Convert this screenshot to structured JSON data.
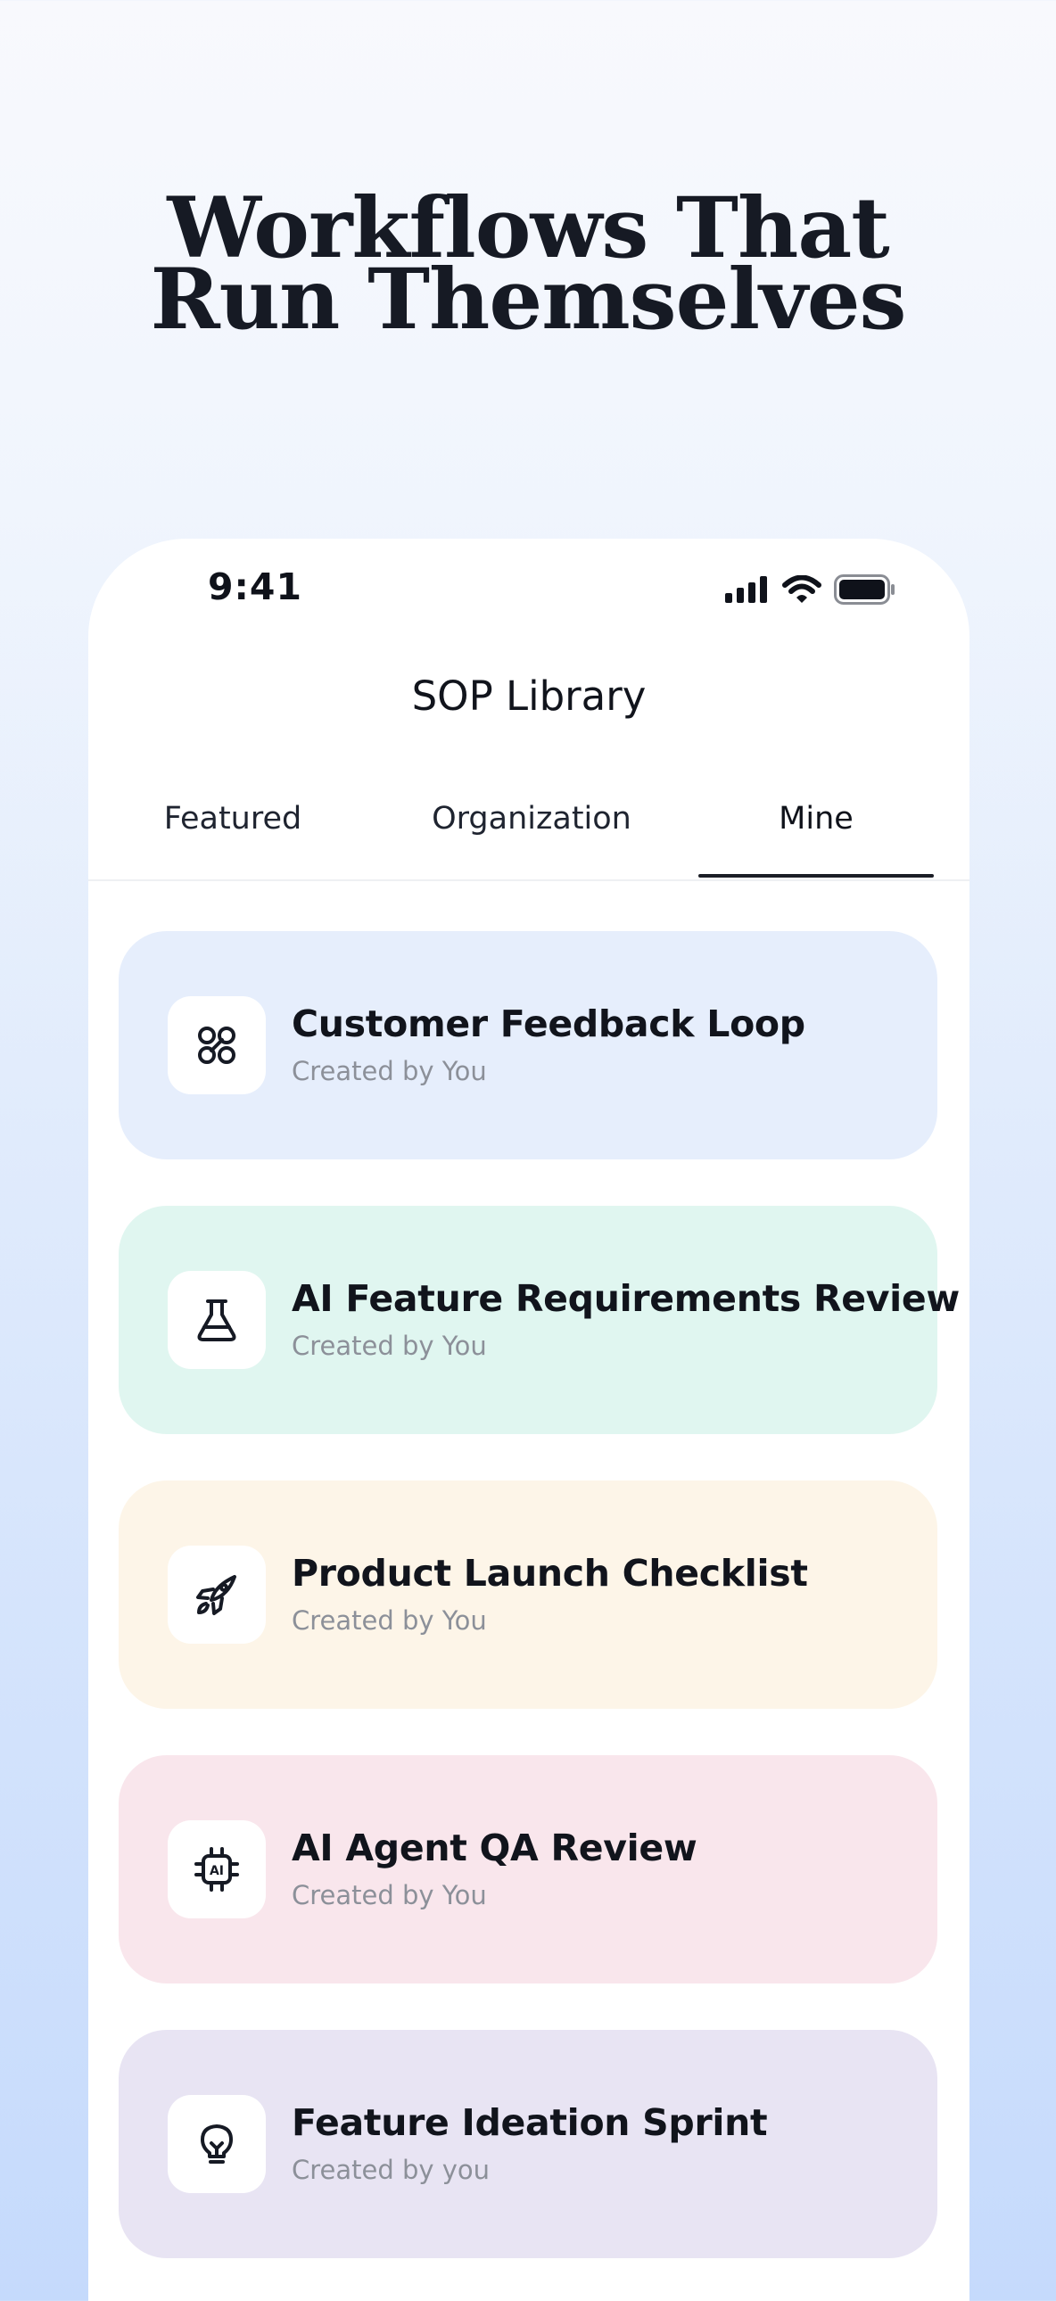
{
  "headline": {
    "line1": "Workflows That",
    "line2": "Run Themselves"
  },
  "status_bar": {
    "time": "9:41"
  },
  "nav": {
    "title": "SOP Library"
  },
  "tabs": [
    {
      "label": "Featured",
      "selected": false
    },
    {
      "label": "Organization",
      "selected": false
    },
    {
      "label": "Mine",
      "selected": true
    }
  ],
  "cards": [
    {
      "title": "Customer Feedback Loop",
      "subtitle": "Created by You",
      "icon": "command-icon",
      "background": "#e6eefc"
    },
    {
      "title": "AI Feature Requirements Review",
      "subtitle": "Created by You",
      "icon": "flask-icon",
      "background": "#e0f6f0"
    },
    {
      "title": "Product Launch Checklist",
      "subtitle": "Created by You",
      "icon": "rocket-icon",
      "background": "#fdf5e8"
    },
    {
      "title": "AI Agent QA Review",
      "subtitle": "Created by You",
      "icon": "ai-chip-icon",
      "background": "#f9e6ec"
    },
    {
      "title": "Feature Ideation Sprint",
      "subtitle": "Created by you",
      "icon": "lightbulb-icon",
      "background": "#e8e4f3"
    }
  ],
  "colors": {
    "accent": "#1b1e26",
    "text": "#11141c",
    "muted": "#8c9099"
  }
}
